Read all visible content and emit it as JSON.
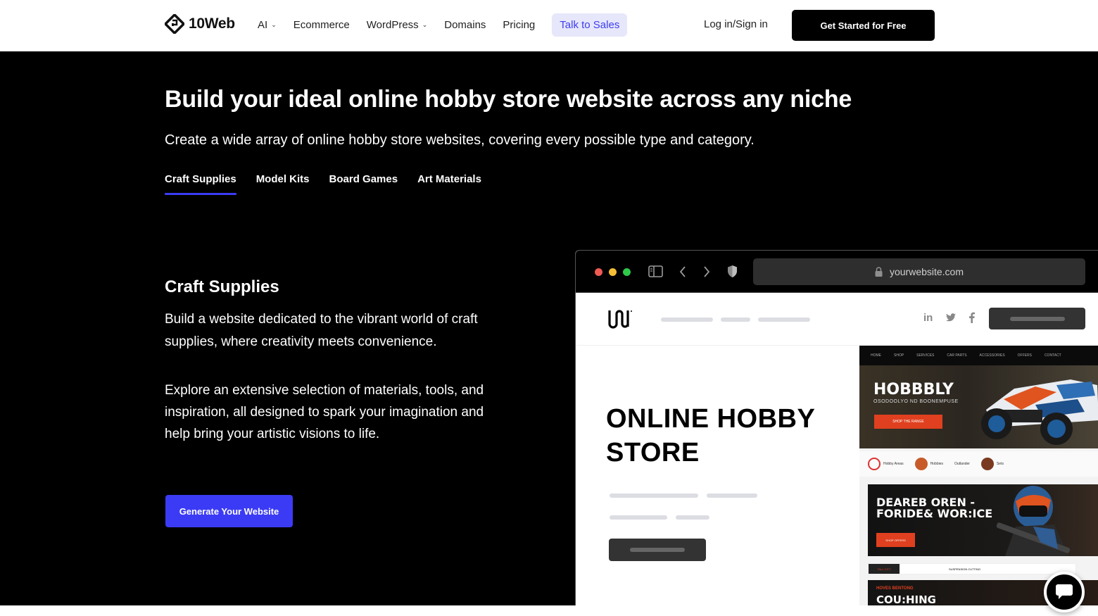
{
  "nav": {
    "brand": "10Web",
    "links": [
      {
        "label": "AI",
        "dropdown": true
      },
      {
        "label": "Ecommerce",
        "dropdown": false
      },
      {
        "label": "WordPress",
        "dropdown": true
      },
      {
        "label": "Domains",
        "dropdown": false
      },
      {
        "label": "Pricing",
        "dropdown": false
      }
    ],
    "talk_to_sales": "Talk to Sales",
    "login": "Log in/Sign in",
    "get_started": "Get Started for Free"
  },
  "hero": {
    "title": "Build your ideal online hobby store website across any niche",
    "subtitle": "Create a wide array of online hobby store websites, covering every possible type and category.",
    "tabs": [
      {
        "label": "Craft Supplies",
        "active": true
      },
      {
        "label": "Model Kits",
        "active": false
      },
      {
        "label": "Board Games",
        "active": false
      },
      {
        "label": "Art Materials",
        "active": false
      }
    ]
  },
  "section": {
    "title": "Craft Supplies",
    "paragraph1": "Build a website dedicated to the vibrant world of craft supplies, where creativity meets convenience.",
    "paragraph2": "Explore an extensive selection of materials, tools, and inspiration, all designed to spark your imagination and help bring your artistic visions to life.",
    "cta": "Generate Your Website"
  },
  "browser": {
    "url": "yourwebsite.com",
    "site_logo": "LOGO",
    "social": [
      "in",
      "twitter",
      "f"
    ],
    "store_title_line1": "ONLINE HOBBY",
    "store_title_line2": "STORE",
    "preview": {
      "nav_items": [
        "HOME",
        "SHOP",
        "SERVICES",
        "CAR PARTS",
        "ACCESSORIES",
        "OFFERS",
        "CONTACT"
      ],
      "hero1_title": "HOBBBLY",
      "hero1_subtitle": "OSODOOLYO ND BOONEMPUSE",
      "hero1_button": "SHOP THE RANGE",
      "features": [
        "Hobby Areas",
        "Hobbies",
        "Outlander",
        "Sets"
      ],
      "hero2_title": "DEAREB OREN - FORIDE& WOR:ICE",
      "hero2_button": "SHOP OFFERS",
      "row_tag": "TALL CITY",
      "row_text": "SUSPENSION CUTTING",
      "hero3_kicker": "HOVES BENTONG",
      "hero3_title": "COU:HING"
    }
  },
  "colors": {
    "accent": "#3b3bf5",
    "talk_bg": "#e7e7fb",
    "talk_text": "#3d3df0",
    "hero_bg": "#000000",
    "preview_orange": "#e0401f"
  }
}
